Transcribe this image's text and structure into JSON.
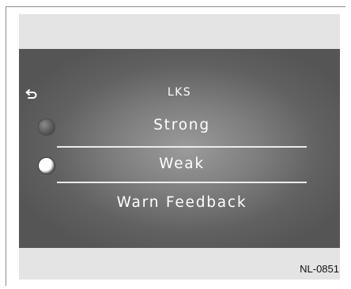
{
  "screen": {
    "title": "LKS",
    "back_icon": "back-arrow-icon",
    "options": [
      {
        "label": "Strong",
        "selected": false
      },
      {
        "label": "Weak",
        "selected": true
      },
      {
        "label": "Warn Feedback",
        "selected": false
      }
    ]
  },
  "figure_code": "NL-0851",
  "colors": {
    "panel_background": "#e4e4e4",
    "screen_background": "#6a6a6a",
    "text": "#ffffff",
    "divider": "#ececec"
  }
}
